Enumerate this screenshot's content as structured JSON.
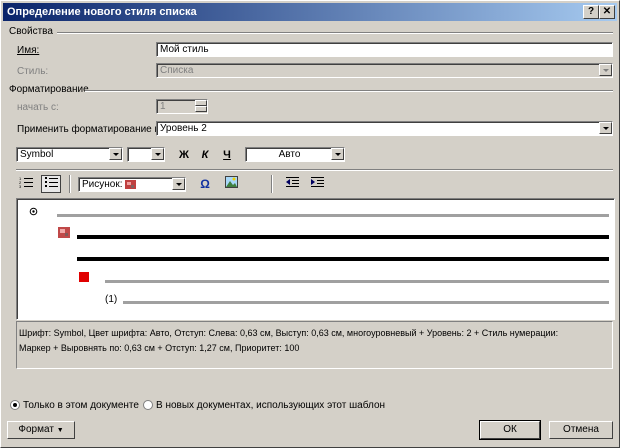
{
  "window": {
    "title": "Определение нового стиля списка"
  },
  "titlebar_buttons": {
    "help": "?",
    "close": "✕"
  },
  "properties": {
    "group_label": "Свойства",
    "name_label": "Имя:",
    "name_value": "Мой стиль",
    "style_label": "Стиль:",
    "style_value": "Списка"
  },
  "formatting": {
    "group_label": "Форматирование",
    "start_label": "начать с:",
    "start_value": "1",
    "apply_label": "Применить форматирование к:",
    "apply_value": "Уровень 2",
    "font_value": "Symbol",
    "size_value": "",
    "bold": "Ж",
    "italic": "К",
    "underline": "Ч",
    "color_value": "Авто",
    "picture_label": "Рисунок:",
    "omega": "Ω"
  },
  "preview": {
    "level4_number": "(1)"
  },
  "description": "Шрифт: Symbol, Цвет шрифта: Авто, Отступ: Слева:  0,63 см, Выступ:  0,63 см, многоуровневый + Уровень: 2 + Стиль нумерации:\nМаркер + Выровнять по:  0,63 см + Отступ:  1,27 см, Приоритет: 100",
  "scope": {
    "option1": "Только в этом документе",
    "option2": "В новых документах, использующих этот шаблон"
  },
  "buttons": {
    "format": "Формат",
    "ok": "ОК",
    "cancel": "Отмена"
  },
  "colors": {
    "title_start": "#0a246a",
    "title_end": "#a6caf0",
    "marker_red": "#e00000"
  }
}
